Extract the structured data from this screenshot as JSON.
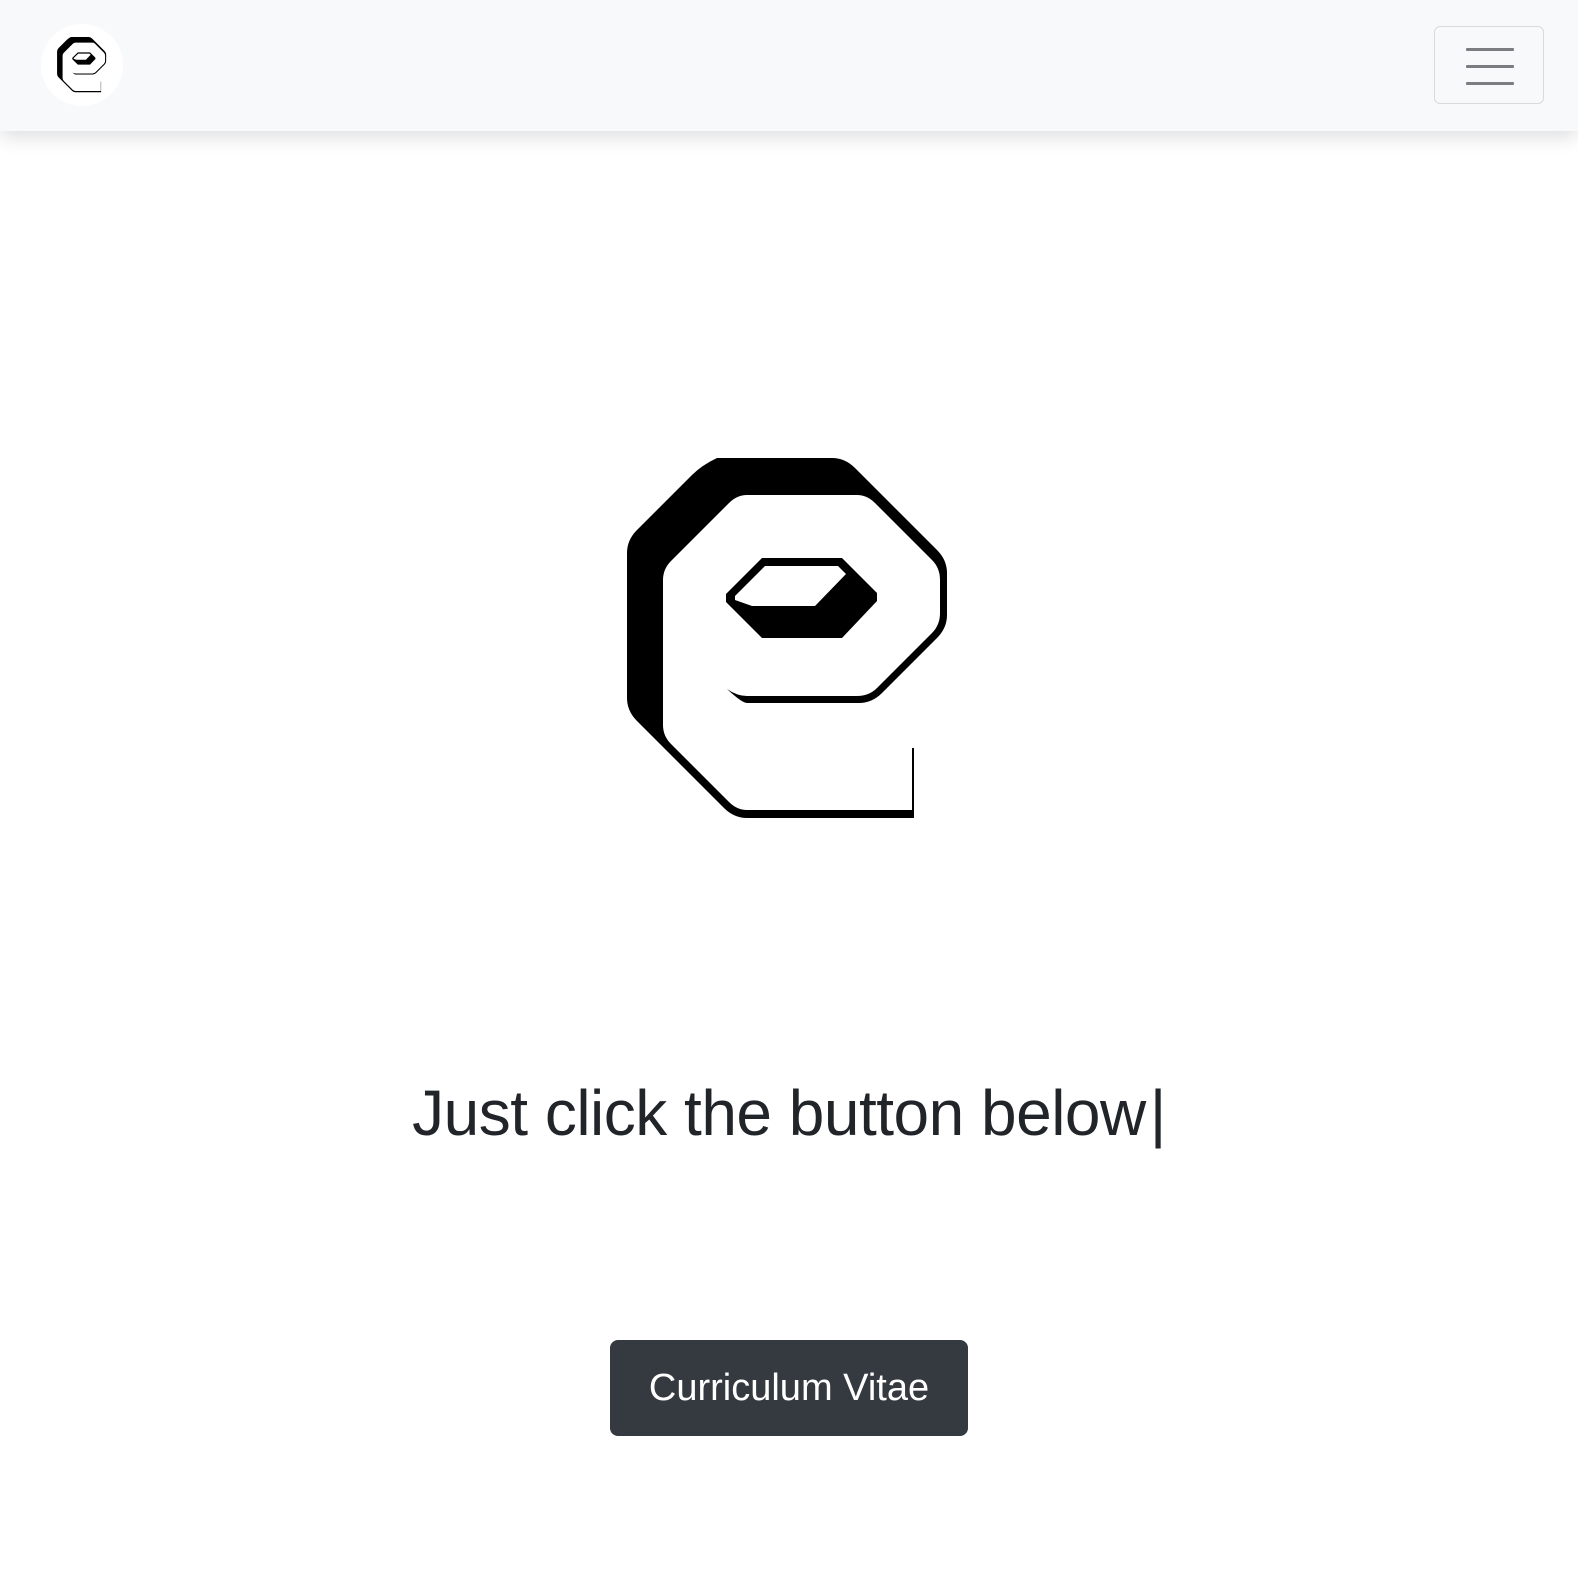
{
  "navbar": {
    "brand_icon": "e-monogram-logo-icon",
    "toggler_icon": "hamburger-menu-icon"
  },
  "hero": {
    "logo_icon": "e-monogram-logo-icon",
    "headline": "Just click the button below",
    "cursor": "|",
    "button_label": "Curriculum Vitae"
  }
}
